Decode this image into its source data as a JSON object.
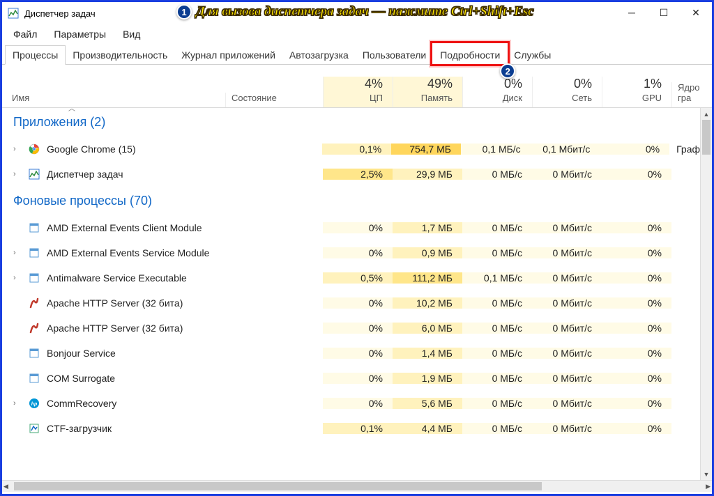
{
  "window": {
    "title": "Диспетчер задач"
  },
  "annotation": {
    "badge1": "1",
    "text": "Для вызова диспетчера задач — нажмите Ctrl+Shift+Esc",
    "badge2": "2"
  },
  "menu": {
    "file": "Файл",
    "options": "Параметры",
    "view": "Вид"
  },
  "tabs": {
    "processes": "Процессы",
    "performance": "Производительность",
    "app_history": "Журнал приложений",
    "startup": "Автозагрузка",
    "users": "Пользователи",
    "details": "Подробности",
    "services": "Службы"
  },
  "columns": {
    "name": "Имя",
    "state": "Состояние",
    "cpu_pct": "4%",
    "cpu_label": "ЦП",
    "mem_pct": "49%",
    "mem_label": "Память",
    "disk_pct": "0%",
    "disk_label": "Диск",
    "net_pct": "0%",
    "net_label": "Сеть",
    "gpu_pct": "1%",
    "gpu_label": "GPU",
    "engine_label": "Ядро гра"
  },
  "groups": {
    "apps": "Приложения (2)",
    "bg": "Фоновые процессы (70)"
  },
  "rows": [
    {
      "group": "apps",
      "expand": true,
      "icon": "chrome",
      "name": "Google Chrome (15)",
      "cpu": "0,1%",
      "mem": "754,7 МБ",
      "disk": "0,1 МБ/с",
      "net": "0,1 Мбит/с",
      "gpu": "0%",
      "engine": "Граф",
      "memHeat": 3,
      "cpuHeat": 1
    },
    {
      "group": "apps",
      "expand": true,
      "icon": "taskmgr",
      "name": "Диспетчер задач",
      "cpu": "2,5%",
      "mem": "29,9 МБ",
      "disk": "0 МБ/с",
      "net": "0 Мбит/с",
      "gpu": "0%",
      "engine": "",
      "memHeat": 1,
      "cpuHeat": 2
    },
    {
      "group": "bg",
      "expand": false,
      "icon": "amd",
      "name": "AMD External Events Client Module",
      "cpu": "0%",
      "mem": "1,7 МБ",
      "disk": "0 МБ/с",
      "net": "0 Мбит/с",
      "gpu": "0%",
      "engine": "",
      "memHeat": 1,
      "cpuHeat": 0
    },
    {
      "group": "bg",
      "expand": true,
      "icon": "amd",
      "name": "AMD External Events Service Module",
      "cpu": "0%",
      "mem": "0,9 МБ",
      "disk": "0 МБ/с",
      "net": "0 Мбит/с",
      "gpu": "0%",
      "engine": "",
      "memHeat": 1,
      "cpuHeat": 0
    },
    {
      "group": "bg",
      "expand": true,
      "icon": "defender",
      "name": "Antimalware Service Executable",
      "cpu": "0,5%",
      "mem": "111,2 МБ",
      "disk": "0,1 МБ/с",
      "net": "0 Мбит/с",
      "gpu": "0%",
      "engine": "",
      "memHeat": 2,
      "cpuHeat": 1
    },
    {
      "group": "bg",
      "expand": false,
      "icon": "apache",
      "name": "Apache HTTP Server (32 бита)",
      "cpu": "0%",
      "mem": "10,2 МБ",
      "disk": "0 МБ/с",
      "net": "0 Мбит/с",
      "gpu": "0%",
      "engine": "",
      "memHeat": 1,
      "cpuHeat": 0
    },
    {
      "group": "bg",
      "expand": false,
      "icon": "apache",
      "name": "Apache HTTP Server (32 бита)",
      "cpu": "0%",
      "mem": "6,0 МБ",
      "disk": "0 МБ/с",
      "net": "0 Мбит/с",
      "gpu": "0%",
      "engine": "",
      "memHeat": 1,
      "cpuHeat": 0
    },
    {
      "group": "bg",
      "expand": false,
      "icon": "generic",
      "name": "Bonjour Service",
      "cpu": "0%",
      "mem": "1,4 МБ",
      "disk": "0 МБ/с",
      "net": "0 Мбит/с",
      "gpu": "0%",
      "engine": "",
      "memHeat": 1,
      "cpuHeat": 0
    },
    {
      "group": "bg",
      "expand": false,
      "icon": "generic",
      "name": "COM Surrogate",
      "cpu": "0%",
      "mem": "1,9 МБ",
      "disk": "0 МБ/с",
      "net": "0 Мбит/с",
      "gpu": "0%",
      "engine": "",
      "memHeat": 1,
      "cpuHeat": 0
    },
    {
      "group": "bg",
      "expand": true,
      "icon": "hp",
      "name": "CommRecovery",
      "cpu": "0%",
      "mem": "5,6 МБ",
      "disk": "0 МБ/с",
      "net": "0 Мбит/с",
      "gpu": "0%",
      "engine": "",
      "memHeat": 1,
      "cpuHeat": 0
    },
    {
      "group": "bg",
      "expand": false,
      "icon": "ctf",
      "name": "CTF-загрузчик",
      "cpu": "0,1%",
      "mem": "4,4 МБ",
      "disk": "0 МБ/с",
      "net": "0 Мбит/с",
      "gpu": "0%",
      "engine": "",
      "memHeat": 1,
      "cpuHeat": 1
    }
  ],
  "scroll": {
    "up": "▲",
    "down": "▼",
    "left": "◀",
    "right": "▶"
  }
}
